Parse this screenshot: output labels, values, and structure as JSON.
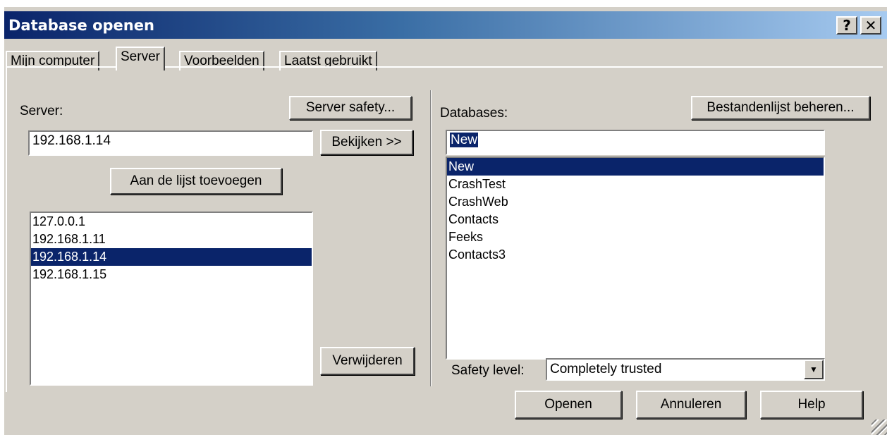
{
  "window": {
    "title": "Database openen",
    "help_btn": "?",
    "close_btn": "✕"
  },
  "tabs": [
    {
      "label": "Mijn computer"
    },
    {
      "label": "Server"
    },
    {
      "label": "Voorbeelden"
    },
    {
      "label": "Laatst gebruikt"
    }
  ],
  "left": {
    "server_label": "Server:",
    "server_safety_btn": "Server safety...",
    "server_input_value": "192.168.1.14",
    "bekijken_btn": "Bekijken >>",
    "add_btn": "Aan de lijst toevoegen",
    "servers": [
      {
        "text": "127.0.0.1"
      },
      {
        "text": "192.168.1.11"
      },
      {
        "text": "192.168.1.14",
        "selected": true
      },
      {
        "text": "192.168.1.15"
      }
    ],
    "remove_btn": "Verwijderen"
  },
  "right": {
    "databases_label": "Databases:",
    "manage_btn": "Bestandenlijst beheren...",
    "db_input_value": "New",
    "databases": [
      {
        "text": "New",
        "selected": true
      },
      {
        "text": "CrashTest"
      },
      {
        "text": "CrashWeb"
      },
      {
        "text": "Contacts"
      },
      {
        "text": "Feeks"
      },
      {
        "text": "Contacts3"
      }
    ],
    "safety_label": "Safety level:",
    "safety_value": "Completely trusted"
  },
  "footer": {
    "open_btn": "Openen",
    "cancel_btn": "Annuleren",
    "help_btn": "Help"
  }
}
